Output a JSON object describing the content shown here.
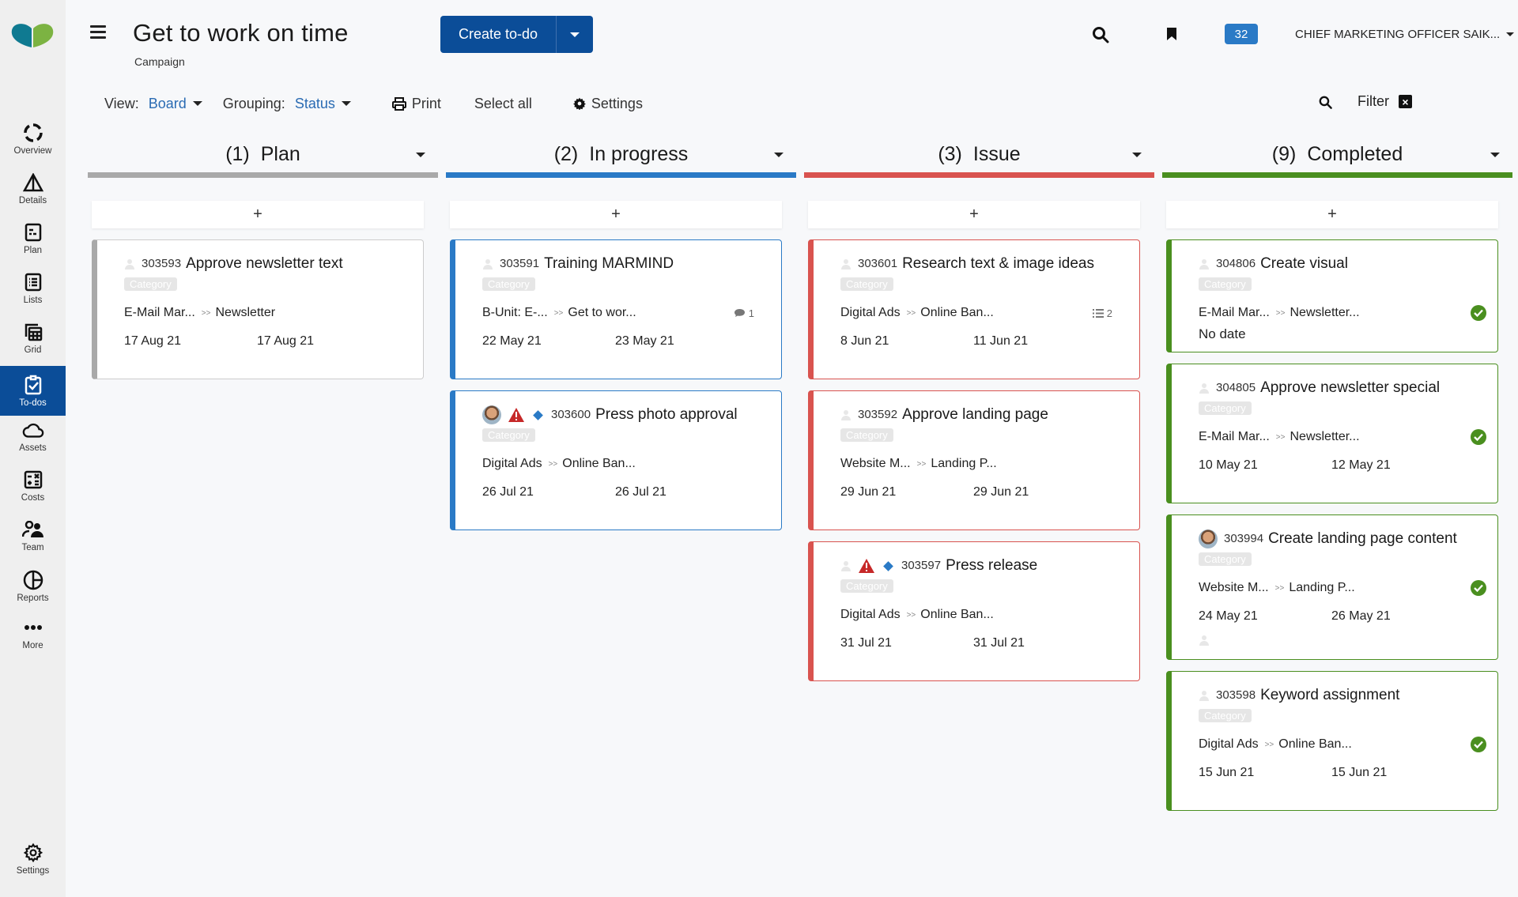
{
  "sidebar": {
    "items": [
      {
        "key": "overview",
        "label": "Overview",
        "icon": "overview-icon"
      },
      {
        "key": "details",
        "label": "Details",
        "icon": "details-icon"
      },
      {
        "key": "plan",
        "label": "Plan",
        "icon": "plan-icon"
      },
      {
        "key": "lists",
        "label": "Lists",
        "icon": "lists-icon"
      },
      {
        "key": "grid",
        "label": "Grid",
        "icon": "grid-icon"
      },
      {
        "key": "todos",
        "label": "To-dos",
        "icon": "todos-icon",
        "active": true
      },
      {
        "key": "assets",
        "label": "Assets",
        "icon": "cloud-icon"
      },
      {
        "key": "costs",
        "label": "Costs",
        "icon": "calculator-icon"
      },
      {
        "key": "team",
        "label": "Team",
        "icon": "team-icon"
      },
      {
        "key": "reports",
        "label": "Reports",
        "icon": "pie-chart-icon"
      },
      {
        "key": "more",
        "label": "More",
        "icon": "more-icon"
      }
    ],
    "settings_label": "Settings"
  },
  "header": {
    "title": "Get to work on time",
    "subtitle": "Campaign",
    "create_button": "Create to-do",
    "notification_count": "32",
    "user": "CHIEF MARKETING OFFICER SAIK..."
  },
  "toolbar": {
    "view_label": "View:",
    "view_value": "Board",
    "grouping_label": "Grouping:",
    "grouping_value": "Status",
    "print_label": "Print",
    "select_all_label": "Select all",
    "settings_label": "Settings",
    "filter_label": "Filter"
  },
  "colors": {
    "plan": "#a9a9a9",
    "in_progress": "#2a7ac6",
    "issue": "#d9534f",
    "completed": "#4a8f1f",
    "brand": "#0b4d98"
  },
  "columns": [
    {
      "count": "(1)",
      "name": "Plan",
      "add": "+",
      "cards": [
        {
          "id": "303593",
          "title": "Approve newsletter text",
          "category": "Category",
          "path_a": "E-Mail Mar...",
          "path_b": "Newsletter",
          "start": "17 Aug 21",
          "end": "17 Aug 21"
        }
      ]
    },
    {
      "count": "(2)",
      "name": "In progress",
      "add": "+",
      "cards": [
        {
          "id": "303591",
          "title": "Training MARMIND",
          "category": "Category",
          "path_a": "B-Unit: E-...",
          "path_b": "Get to wor...",
          "comments": "1",
          "start": "22 May 21",
          "end": "23 May 21"
        },
        {
          "id": "303600",
          "title": "Press photo approval",
          "category": "Category",
          "path_a": "Digital Ads",
          "path_b": "Online Ban...",
          "start": "26 Jul 21",
          "end": "26 Jul 21",
          "avatar": true,
          "warning": true,
          "milestone": true
        }
      ]
    },
    {
      "count": "(3)",
      "name": "Issue",
      "add": "+",
      "cards": [
        {
          "id": "303601",
          "title": "Research text & image ideas",
          "category": "Category",
          "path_a": "Digital Ads",
          "path_b": "Online Ban...",
          "subtasks": "2",
          "start": "8 Jun 21",
          "end": "11 Jun 21"
        },
        {
          "id": "303592",
          "title": "Approve landing page",
          "category": "Category",
          "path_a": "Website M...",
          "path_b": "Landing P...",
          "start": "29 Jun 21",
          "end": "29 Jun 21"
        },
        {
          "id": "303597",
          "title": "Press release",
          "category": "Category",
          "path_a": "Digital Ads",
          "path_b": "Online Ban...",
          "start": "31 Jul 21",
          "end": "31 Jul 21",
          "warning": true,
          "milestone": true
        }
      ]
    },
    {
      "count": "(9)",
      "name": "Completed",
      "add": "+",
      "cards": [
        {
          "id": "304806",
          "title": "Create visual",
          "category": "Category",
          "path_a": "E-Mail Mar...",
          "path_b": "Newsletter...",
          "no_date": "No date",
          "done": true
        },
        {
          "id": "304805",
          "title": "Approve newsletter special",
          "category": "Category",
          "path_a": "E-Mail Mar...",
          "path_b": "Newsletter...",
          "start": "10 May 21",
          "end": "12 May 21",
          "done": true
        },
        {
          "id": "303994",
          "title": "Create landing page content",
          "category": "Category",
          "path_a": "Website M...",
          "path_b": "Landing P...",
          "start": "24 May 21",
          "end": "26 May 21",
          "done": true,
          "avatar": true,
          "extra_person": true
        },
        {
          "id": "303598",
          "title": "Keyword assignment",
          "category": "Category",
          "path_a": "Digital Ads",
          "path_b": "Online Ban...",
          "start": "15 Jun 21",
          "end": "15 Jun 21",
          "done": true
        }
      ]
    }
  ]
}
